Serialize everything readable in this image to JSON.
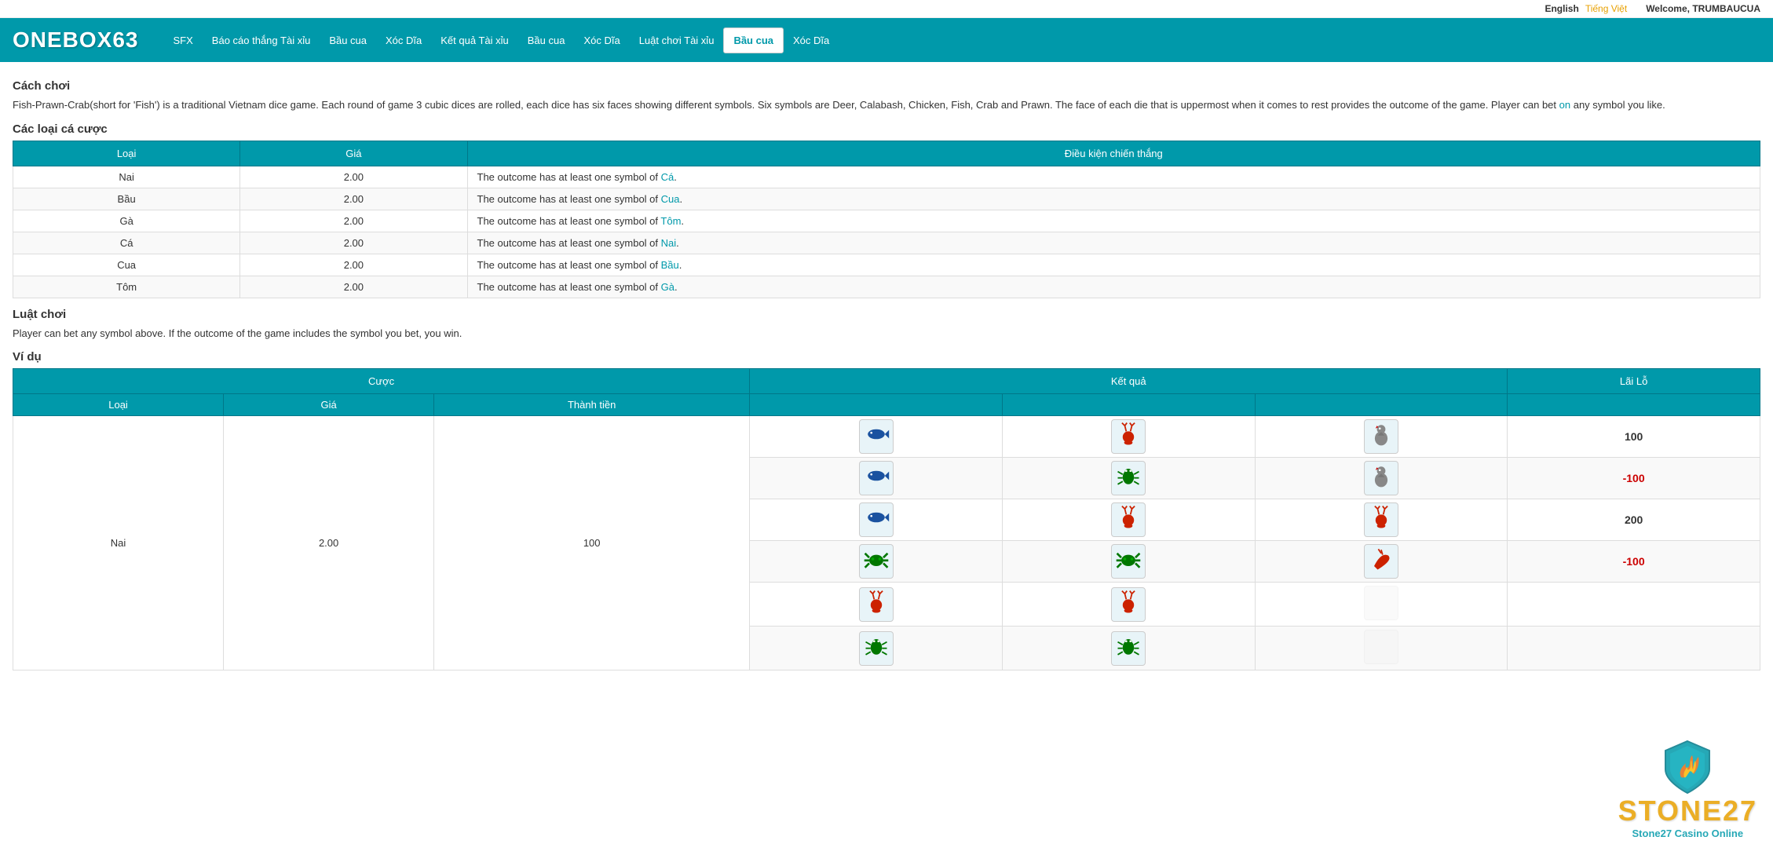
{
  "topbar": {
    "lang_en": "English",
    "lang_vn": "Tiếng Việt",
    "welcome": "Welcome,",
    "username": "TRUMBAUCUA"
  },
  "header": {
    "logo": "ONEBOX63",
    "nav": [
      {
        "label": "SFX",
        "active": false
      },
      {
        "label": "Báo cáo thắng Tài xỉu",
        "active": false
      },
      {
        "label": "Bầu cua",
        "active": false
      },
      {
        "label": "Xóc Dĩa",
        "active": false
      },
      {
        "label": "Kết quả Tài xỉu",
        "active": false
      },
      {
        "label": "Bầu cua",
        "active": false
      },
      {
        "label": "Xóc Dĩa",
        "active": false
      },
      {
        "label": "Luật chơi Tài xỉu",
        "active": false
      },
      {
        "label": "Bầu cua",
        "active": true
      },
      {
        "label": "Xóc Dĩa",
        "active": false
      }
    ]
  },
  "cach_choi": {
    "title": "Cách chơi",
    "desc": "Fish-Prawn-Crab(short for 'Fish') is a traditional Vietnam dice game. Each round of game 3 cubic dices are rolled, each dice has six faces showing different symbols. Six symbols are Deer, Calabash, Chicken, Fish, Crab and Prawn. The face of each die that is uppermost when it comes to rest provides the outcome of the game. Player can bet on any symbol you like."
  },
  "cac_loai": {
    "title": "Các loại cá cược",
    "headers": [
      "Loại",
      "Giá",
      "Điều kiện chiến thắng"
    ],
    "rows": [
      {
        "loai": "Nai",
        "gia": "2.00",
        "dieu_kien": "The outcome has at least one symbol of Cá."
      },
      {
        "loai": "Bầu",
        "gia": "2.00",
        "dieu_kien": "The outcome has at least one symbol of Cua."
      },
      {
        "loai": "Gà",
        "gia": "2.00",
        "dieu_kien": "The outcome has at least one symbol of Tôm."
      },
      {
        "loai": "Cá",
        "gia": "2.00",
        "dieu_kien": "The outcome has at least one symbol of Nai."
      },
      {
        "loai": "Cua",
        "gia": "2.00",
        "dieu_kien": "The outcome has at least one symbol of Bầu."
      },
      {
        "loai": "Tôm",
        "gia": "2.00",
        "dieu_kien": "The outcome has at least one symbol of Gà."
      }
    ],
    "highlight_words": [
      "Cá.",
      "Cua.",
      "Tôm.",
      "Nai.",
      "Bầu.",
      "Gà."
    ]
  },
  "luat_choi": {
    "title": "Luật chơi",
    "desc": "Player can bet any symbol above. If the outcome of the game includes the symbol you bet, you win."
  },
  "vi_du": {
    "title": "Ví dụ",
    "header_cuoc": "Cược",
    "header_ketqua": "Kết quả",
    "header_lailo": "Lãi Lỗ",
    "sub_headers_cuoc": [
      "Loại",
      "Giá",
      "Thành tiền"
    ],
    "example_loai": "Nai",
    "example_gia": "2.00",
    "example_thanhtien": "100",
    "rows": [
      {
        "icons": [
          "🦈",
          "🦌",
          "🐓"
        ],
        "colors": [
          "blue",
          "red",
          "gray"
        ],
        "profit": "100",
        "positive": true
      },
      {
        "icons": [
          "🦈",
          "🦟",
          "🐓"
        ],
        "colors": [
          "blue",
          "green",
          "gray"
        ],
        "profit": "-100",
        "positive": false
      },
      {
        "icons": [
          "🦈",
          "🦌",
          "🦌"
        ],
        "colors": [
          "blue",
          "red",
          "red"
        ],
        "profit": "200",
        "positive": true
      },
      {
        "icons": [
          "🦀",
          "🦀",
          "🦐"
        ],
        "colors": [
          "green",
          "green",
          "red"
        ],
        "profit": "-100",
        "positive": false
      },
      {
        "icons": [
          "🦌",
          "🦌",
          ""
        ],
        "colors": [
          "red",
          "red",
          ""
        ],
        "profit": "",
        "positive": true
      },
      {
        "icons": [
          "🦟",
          "🦟",
          ""
        ],
        "colors": [
          "green",
          "green",
          ""
        ],
        "profit": "",
        "positive": true
      }
    ]
  },
  "watermark": {
    "big": "STONE27",
    "small": "Stone27 Casino Online"
  }
}
